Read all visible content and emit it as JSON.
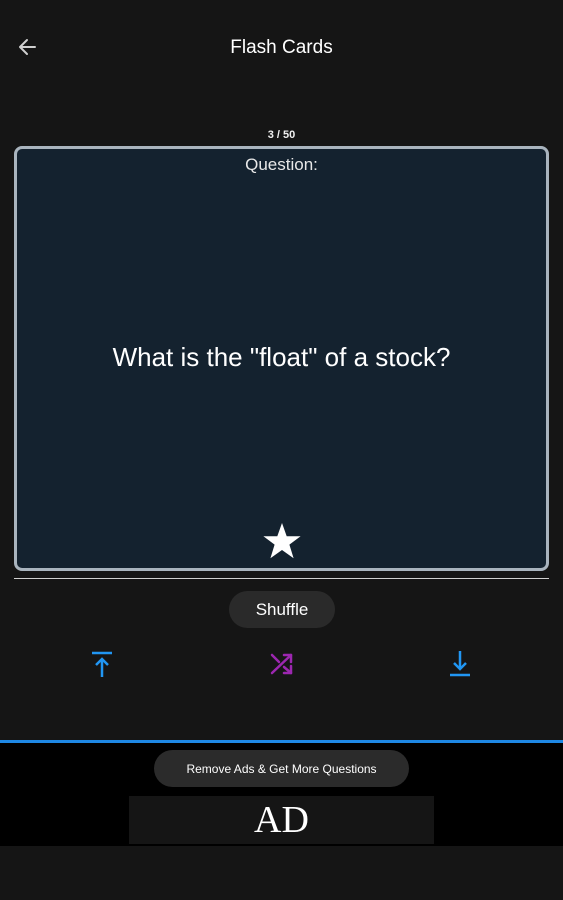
{
  "header": {
    "title": "Flash Cards",
    "back_icon": "arrow-left-icon"
  },
  "progress": {
    "current": 3,
    "total": 50,
    "label": "3 / 50"
  },
  "card": {
    "label": "Question:",
    "question": "What is the \"float\" of a stock?",
    "favorite_icon": "star-icon",
    "background": "#14222f",
    "border_color": "#a9b4be"
  },
  "controls": {
    "shuffle_label": "Shuffle",
    "first_icon": "jump-to-top-icon",
    "shuffle_icon": "shuffle-icon",
    "last_icon": "jump-to-bottom-icon",
    "icon_colors": {
      "first": "#2196f3",
      "shuffle": "#9c27b0",
      "last": "#2196f3"
    }
  },
  "ad_panel": {
    "remove_ads_label": "Remove Ads & Get More Questions",
    "ad_label": "AD",
    "accent": "#1e88e5"
  }
}
